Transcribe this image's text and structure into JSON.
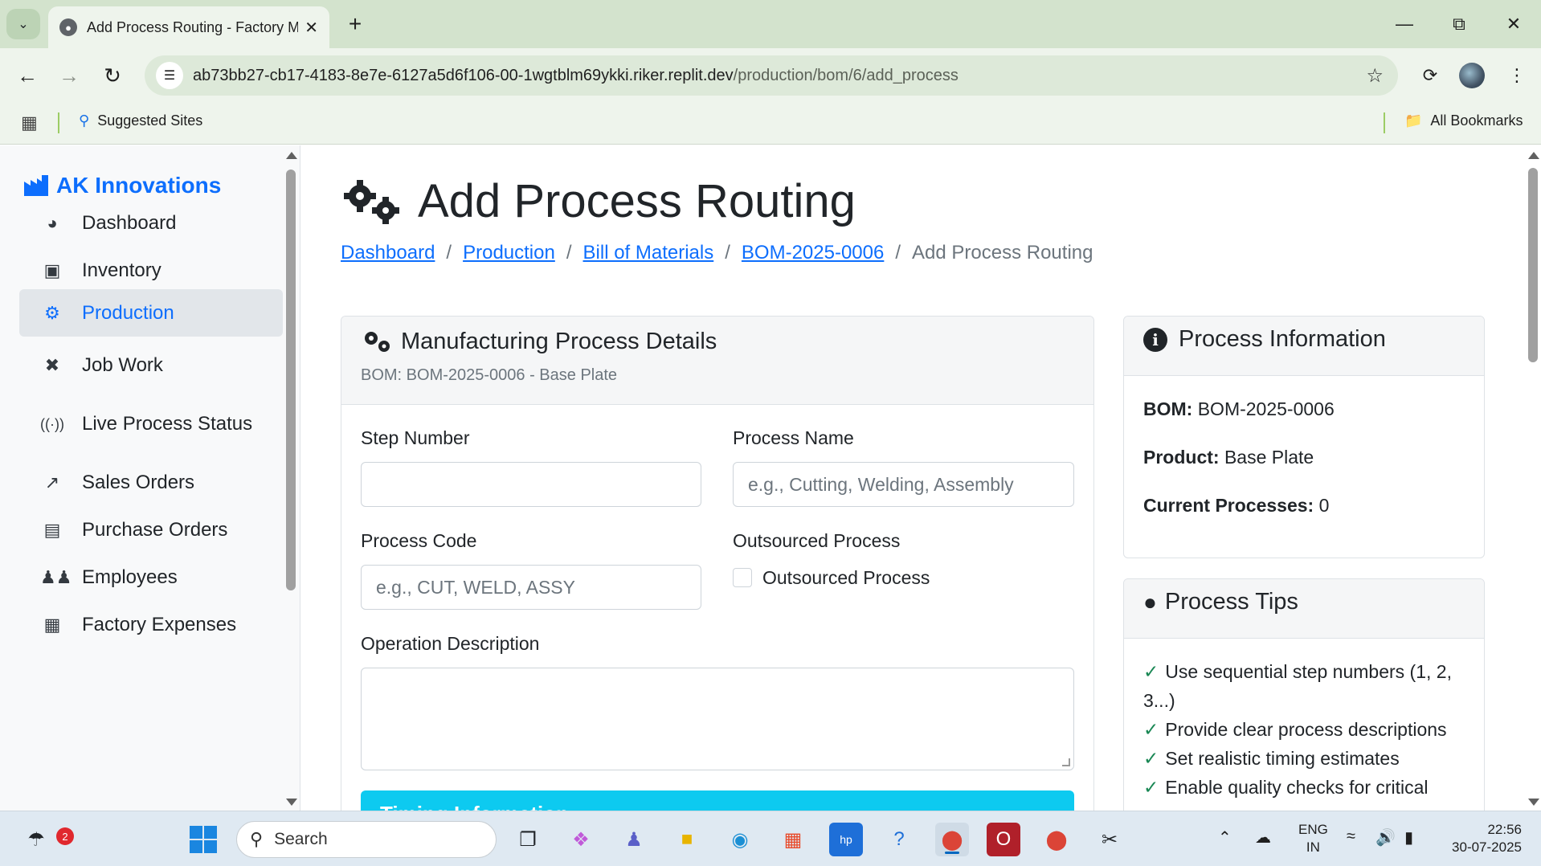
{
  "browser": {
    "tab_title": "Add Process Routing - Factory M",
    "url_host": "ab73bb27-cb17-4183-8e7e-6127a5d6f106-00-1wgtblm69ykki.riker.replit.dev",
    "url_path": "/production/bom/6/add_process",
    "bookmarks": {
      "suggested": "Suggested Sites",
      "all": "All Bookmarks"
    }
  },
  "sidebar": {
    "brand": "AK Innovations",
    "items": [
      {
        "label": "Dashboard",
        "icon": "palette-icon"
      },
      {
        "label": "Inventory",
        "icon": "boxes-icon"
      },
      {
        "label": "Production",
        "icon": "gears-icon"
      },
      {
        "label": "Job Work",
        "icon": "tools-icon"
      },
      {
        "label": "Live Process Status",
        "icon": "broadcast-icon"
      },
      {
        "label": "Sales Orders",
        "icon": "chart-line-icon"
      },
      {
        "label": "Purchase Orders",
        "icon": "file-icon"
      },
      {
        "label": "Employees",
        "icon": "users-icon"
      },
      {
        "label": "Factory Expenses",
        "icon": "receipt-icon"
      }
    ],
    "active": "Production"
  },
  "page": {
    "title": "Add Process Routing",
    "breadcrumb": [
      "Dashboard",
      "Production",
      "Bill of Materials",
      "BOM-2025-0006",
      "Add Process Routing"
    ]
  },
  "form": {
    "header": "Manufacturing Process Details",
    "subtitle": "BOM: BOM-2025-0006 - Base Plate",
    "step_number_label": "Step Number",
    "step_number_value": "",
    "process_name_label": "Process Name",
    "process_name_placeholder": "e.g., Cutting, Welding, Assembly",
    "process_code_label": "Process Code",
    "process_code_placeholder": "e.g., CUT, WELD, ASSY",
    "outsourced_label": "Outsourced Process",
    "outsourced_checkbox_label": "Outsourced Process",
    "operation_description_label": "Operation Description",
    "timing_section": "Timing Information"
  },
  "info": {
    "header": "Process Information",
    "bom_label": "BOM:",
    "bom_value": "BOM-2025-0006",
    "product_label": "Product:",
    "product_value": "Base Plate",
    "processes_label": "Current Processes:",
    "processes_value": "0"
  },
  "tips": {
    "header": "Process Tips",
    "items": [
      "Use sequential step numbers (1, 2, 3...)",
      "Provide clear process descriptions",
      "Set realistic timing estimates",
      "Enable quality checks for critical"
    ]
  },
  "taskbar": {
    "search": "Search",
    "weather_badge": "2",
    "lang_line1": "ENG",
    "lang_line2": "IN",
    "time": "22:56",
    "date": "30-07-2025"
  },
  "colors": {
    "primary": "#0d6efd",
    "info": "#0dcaf0",
    "success": "#198754",
    "sidebar_bg": "#f8f9fa"
  }
}
